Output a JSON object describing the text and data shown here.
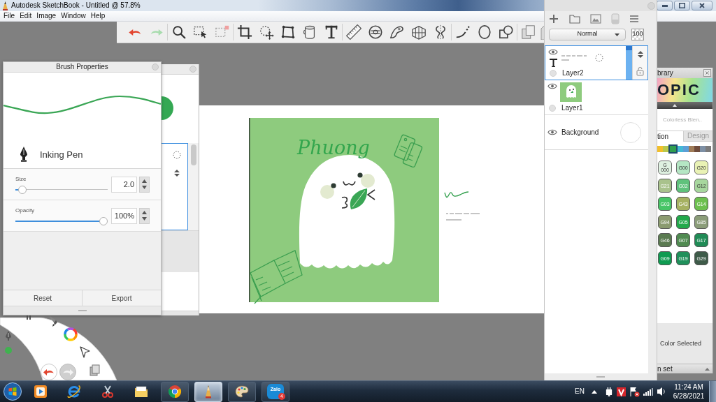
{
  "window": {
    "title": "Autodesk SketchBook - Untitled @ 57.8%"
  },
  "menu_bar": [
    "File",
    "Edit",
    "Image",
    "Window",
    "Help"
  ],
  "canvas": {
    "lettering": "Phuong"
  },
  "brush_properties": {
    "title": "Brush Properties",
    "brush_name": "Inking Pen",
    "sliders": [
      {
        "label": "Size",
        "value": "2.0",
        "level": 0.03
      },
      {
        "label": "Opacity",
        "value": "100%",
        "level": 1
      }
    ],
    "buttons": [
      "Reset",
      "Export"
    ]
  },
  "layers_panel": {
    "blend_mode": "Normal",
    "opacity": "100",
    "layers": [
      {
        "name": "Layer2",
        "kind": "text",
        "selected": true,
        "visible": true
      },
      {
        "name": "Layer1",
        "kind": "image",
        "selected": false,
        "visible": true
      },
      {
        "name": "Background",
        "kind": "background",
        "selected": false,
        "visible": true
      }
    ]
  },
  "color_library": {
    "title": "brary",
    "logo": "OPIC",
    "set_name": "Colorless Blen..",
    "tabs": [
      {
        "label": "tion",
        "selected": true
      },
      {
        "label": "Design",
        "selected": false
      }
    ],
    "strip": [
      {
        "color": "#f2bf2c",
        "selected": false
      },
      {
        "color": "#b9c94c",
        "selected": false
      },
      {
        "color": "#2f9e4f",
        "selected": true
      },
      {
        "color": "#43b9d6",
        "selected": false
      },
      {
        "color": "#5c9fd6",
        "selected": false
      },
      {
        "color": "#a07c58",
        "selected": false
      },
      {
        "color": "#6f4c3c",
        "selected": false
      },
      {
        "color": "#7d8fa4",
        "selected": false
      },
      {
        "color": "#7b7b7b",
        "selected": false
      }
    ],
    "swatches": [
      {
        "label": "G 000",
        "color": "#dff1e1"
      },
      {
        "label": "G00",
        "color": "#b5e6c4"
      },
      {
        "label": "G20",
        "color": "#e9f2b5"
      },
      {
        "label": "G21",
        "color": "#a9c28c"
      },
      {
        "label": "G02",
        "color": "#5fc27c"
      },
      {
        "label": "G12",
        "color": "#a7d79e"
      },
      {
        "label": "G03",
        "color": "#47c566"
      },
      {
        "label": "G43",
        "color": "#a6b162"
      },
      {
        "label": "G14",
        "color": "#6cc04f"
      },
      {
        "label": "G94",
        "color": "#8b9b6f"
      },
      {
        "label": "G05",
        "color": "#22a94b"
      },
      {
        "label": "G85",
        "color": "#8b9d79"
      },
      {
        "label": "G46",
        "color": "#5b7b51"
      },
      {
        "label": "G07",
        "color": "#508b51"
      },
      {
        "label": "G17",
        "color": "#208b56"
      },
      {
        "label": "G09",
        "color": "#0f9b51"
      },
      {
        "label": "G19",
        "color": "#20905b"
      },
      {
        "label": "G29",
        "color": "#3e5b49"
      }
    ],
    "status": "Color Selected",
    "footer": "n set"
  },
  "taskbar": {
    "apps": [
      {
        "kind": "player",
        "running": false,
        "selected": false
      },
      {
        "kind": "browser",
        "running": false,
        "selected": false
      },
      {
        "kind": "snipping",
        "running": false,
        "selected": false
      },
      {
        "kind": "files",
        "running": false,
        "selected": false
      },
      {
        "kind": "web",
        "running": true,
        "selected": false
      },
      {
        "kind": "sketch",
        "running": true,
        "selected": true
      },
      {
        "kind": "paint",
        "running": true,
        "selected": false
      },
      {
        "kind": "chat",
        "label": "Zalo",
        "badge": "4",
        "running": true,
        "selected": false
      }
    ],
    "language": "EN",
    "time": "11:24 AM",
    "date": "6/28/2021"
  }
}
